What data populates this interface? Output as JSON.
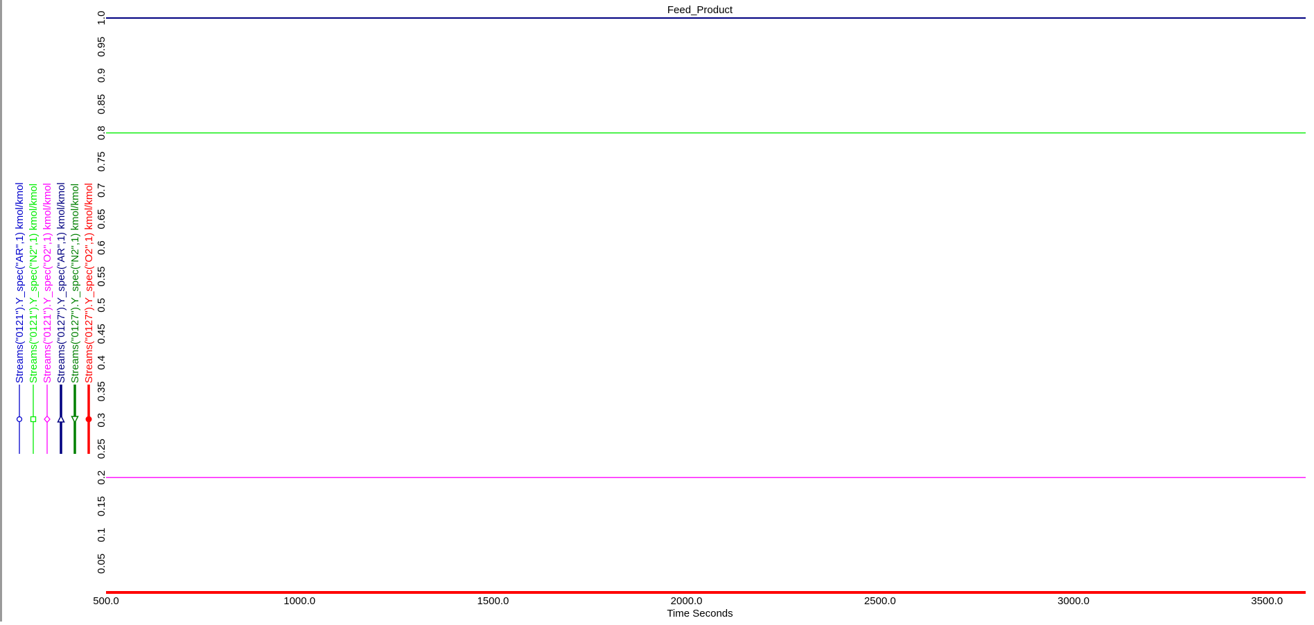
{
  "chart_data": {
    "type": "line",
    "title": "Feed_Product",
    "xlabel": "Time Seconds",
    "ylabel": "",
    "xlim": [
      500,
      3600
    ],
    "ylim": [
      0,
      1.0
    ],
    "x_ticks": [
      "500.0",
      "1000.0",
      "1500.0",
      "2000.0",
      "2500.0",
      "3000.0",
      "3500.0"
    ],
    "x_tick_values": [
      500,
      1000,
      1500,
      2000,
      2500,
      3000,
      3500
    ],
    "y_ticks": [
      "0.05",
      "0.1",
      "0.15",
      "0.2",
      "0.25",
      "0.3",
      "0.35",
      "0.4",
      "0.45",
      "0.5",
      "0.55",
      "0.6",
      "0.65",
      "0.7",
      "0.75",
      "0.8",
      "0.85",
      "0.9",
      "0.95",
      "1.0"
    ],
    "y_tick_values": [
      0.05,
      0.1,
      0.15,
      0.2,
      0.25,
      0.3,
      0.35,
      0.4,
      0.45,
      0.5,
      0.55,
      0.6,
      0.65,
      0.7,
      0.75,
      0.8,
      0.85,
      0.9,
      0.95,
      1.0
    ],
    "grid": false,
    "legend_position": "left",
    "series": [
      {
        "name": "Streams(\"0121\").Y_spec(\"AR\",1) kmol/kmol",
        "color": "#0000cc",
        "marker": "circle",
        "thick": false,
        "x": [
          500,
          3600
        ],
        "y": [
          0.0,
          0.0
        ]
      },
      {
        "name": "Streams(\"0121\").Y_spec(\"N2\",1) kmol/kmol",
        "color": "#00ee00",
        "marker": "square",
        "thick": false,
        "x": [
          500,
          3600
        ],
        "y": [
          0.8,
          0.8
        ]
      },
      {
        "name": "Streams(\"0121\").Y_spec(\"O2\",1) kmol/kmol",
        "color": "#ff00ff",
        "marker": "diamond",
        "thick": false,
        "x": [
          500,
          3600
        ],
        "y": [
          0.2,
          0.2
        ]
      },
      {
        "name": "Streams(\"0127\").Y_spec(\"AR\",1) kmol/kmol",
        "color": "#000080",
        "marker": "triangle",
        "thick": true,
        "x": [
          500,
          3600
        ],
        "y": [
          1.0,
          1.0
        ]
      },
      {
        "name": "Streams(\"0127\").Y_spec(\"N2\",1) kmol/kmol",
        "color": "#008000",
        "marker": "triangle-down",
        "thick": true,
        "x": [
          500,
          3600
        ],
        "y": [
          0.0,
          0.0
        ]
      },
      {
        "name": "Streams(\"0127\").Y_spec(\"O2\",1) kmol/kmol",
        "color": "#ff0000",
        "marker": "circle-filled",
        "thick": true,
        "x": [
          500,
          3600
        ],
        "y": [
          0.0,
          0.0
        ]
      }
    ]
  }
}
